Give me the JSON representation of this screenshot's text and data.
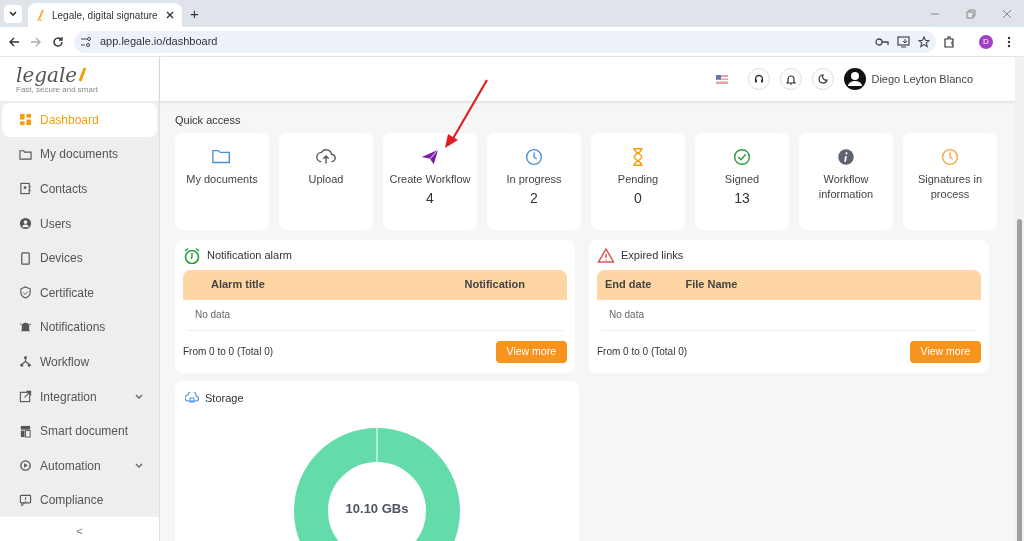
{
  "browser": {
    "tab_title": "Legale, digital signature",
    "new_tab": "+",
    "url": "app.legale.io/dashboard",
    "profile_initial": "D"
  },
  "logo": {
    "text": "legale",
    "tagline": "Fast, secure and smart"
  },
  "sidebar": {
    "items": [
      {
        "label": "Dashboard",
        "selected": true,
        "has_submenu": false
      },
      {
        "label": "My documents",
        "selected": false,
        "has_submenu": false
      },
      {
        "label": "Contacts",
        "selected": false,
        "has_submenu": false
      },
      {
        "label": "Users",
        "selected": false,
        "has_submenu": false
      },
      {
        "label": "Devices",
        "selected": false,
        "has_submenu": false
      },
      {
        "label": "Certificate",
        "selected": false,
        "has_submenu": false
      },
      {
        "label": "Notifications",
        "selected": false,
        "has_submenu": false
      },
      {
        "label": "Workflow",
        "selected": false,
        "has_submenu": false
      },
      {
        "label": "Integration",
        "selected": false,
        "has_submenu": true
      },
      {
        "label": "Smart document",
        "selected": false,
        "has_submenu": false
      },
      {
        "label": "Automation",
        "selected": false,
        "has_submenu": true
      },
      {
        "label": "Compliance",
        "selected": false,
        "has_submenu": false
      }
    ],
    "collapse": "<"
  },
  "header": {
    "user_name": "Diego Leyton Blanco"
  },
  "quick_access": {
    "title": "Quick access",
    "cards": [
      {
        "label": "My documents"
      },
      {
        "label": "Upload"
      },
      {
        "label": "Create Workflow",
        "count": "4"
      },
      {
        "label": "In progress",
        "count": "2"
      },
      {
        "label": "Pending",
        "count": "0"
      },
      {
        "label": "Signed",
        "count": "13"
      },
      {
        "label": "Workflow information"
      },
      {
        "label": "Signatures in process"
      }
    ]
  },
  "panels": [
    {
      "title": "Notification alarm",
      "columns": [
        "Alarm title",
        "Notification"
      ],
      "empty_text": "No data",
      "footer": "From 0 to 0 (Total 0)",
      "button": "View more"
    },
    {
      "title": "Expired links",
      "columns": [
        "End date",
        "File Name"
      ],
      "empty_text": "No data",
      "footer": "From 0 to 0 (Total 0)",
      "button": "View more"
    }
  ],
  "storage": {
    "title": "Storage",
    "center_label": "10.10 GBs"
  }
}
